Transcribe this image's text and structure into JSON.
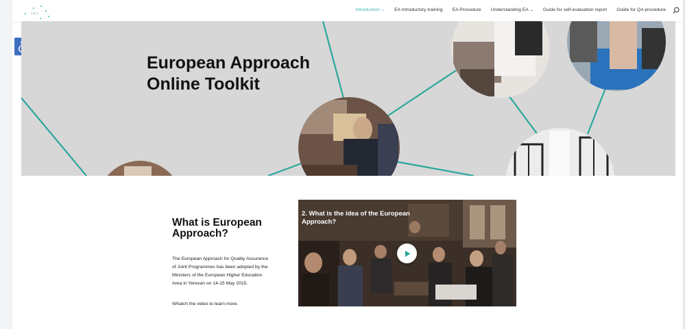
{
  "header": {
    "logo_text": "EMQT",
    "nav": [
      {
        "label": "Introduction",
        "active": true,
        "caret": true
      },
      {
        "label": "EA Introductory training",
        "active": false,
        "caret": false
      },
      {
        "label": "EA Procedure",
        "active": false,
        "caret": false
      },
      {
        "label": "Understanding EA",
        "active": false,
        "caret": true
      },
      {
        "label": "Guide for self-evaluation report",
        "active": false,
        "caret": false
      },
      {
        "label": "Guide for QA procedure",
        "active": false,
        "caret": false
      }
    ]
  },
  "hero": {
    "title_line1": "European Approach",
    "title_line2": "Online Toolkit"
  },
  "intro": {
    "title": "What is European Approach?",
    "body": "The European Approach for Quality Assurance of Joint Programmes has been adopted by the Ministers of the European Higher Education Area in Yerevan on 14-15 May 2015.",
    "cta": "Whatch the video to learn more."
  },
  "video": {
    "title": "2. What is the idea of the European Approach?"
  },
  "icons": {
    "accessibility": "accessibility-icon",
    "search": "search-icon",
    "play": "play-icon"
  },
  "colors": {
    "accent": "#3bb7b0",
    "accessibility_bg": "#3d6fc1",
    "hero_bg": "#d7d7d7"
  }
}
